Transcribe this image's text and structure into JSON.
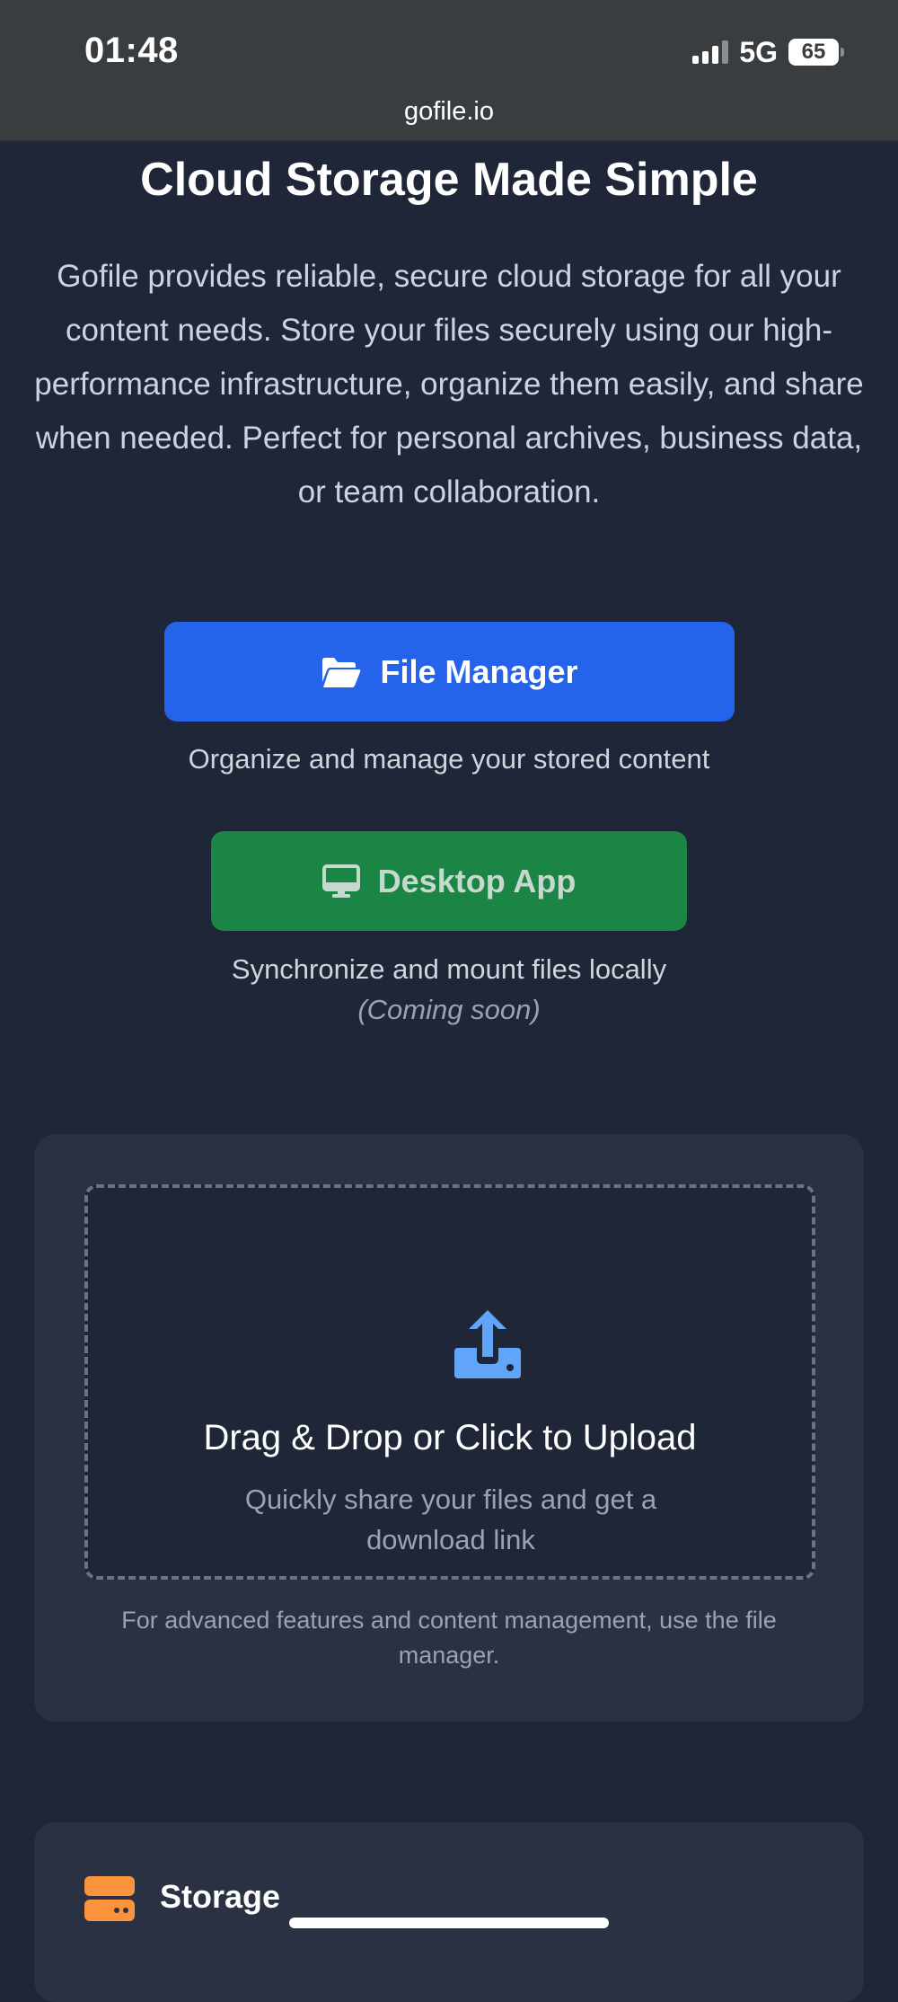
{
  "status_bar": {
    "time": "01:48",
    "network": "5G",
    "battery": "65",
    "url": "gofile.io"
  },
  "hero": {
    "title": "Cloud Storage Made Simple",
    "description": "Gofile provides reliable, secure cloud storage for all your content needs. Store your files securely using our high-performance infrastructure, organize them easily, and share when needed. Perfect for personal archives, business data, or team collaboration."
  },
  "actions": {
    "file_manager": {
      "label": "File Manager",
      "caption": "Organize and manage your stored content",
      "icon": "folder-open-icon",
      "color": "#2563eb"
    },
    "desktop_app": {
      "label": "Desktop App",
      "caption": "Synchronize and mount files locally",
      "note": "(Coming soon)",
      "icon": "desktop-icon",
      "color": "#1b8545"
    }
  },
  "upload": {
    "title": "Drag & Drop or Click to Upload",
    "subtitle": "Quickly share your files and get a download link",
    "note": "For advanced features and content management, use the file manager.",
    "icon": "upload-icon",
    "icon_color": "#60a5fa"
  },
  "storage": {
    "title": "Storage",
    "icon": "server-icon",
    "icon_color": "#fb923c"
  }
}
